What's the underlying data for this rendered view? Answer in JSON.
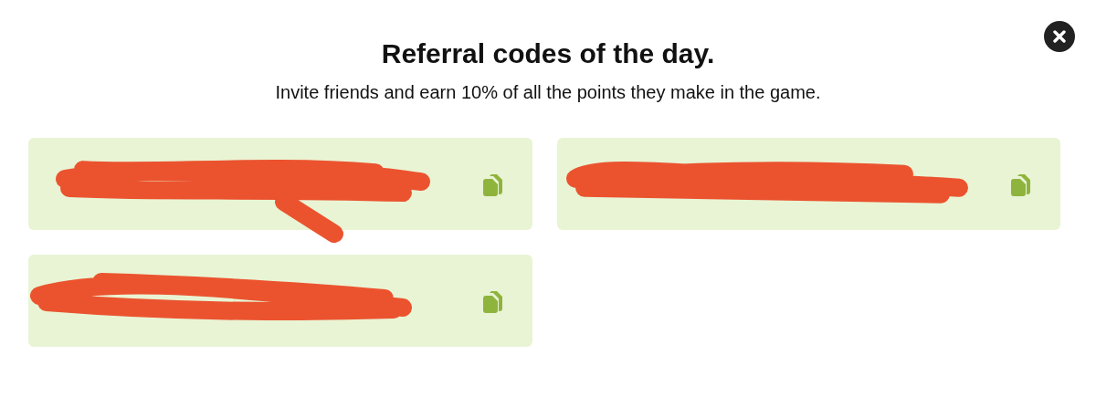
{
  "dialog": {
    "title": "Referral codes of the day.",
    "subtitle": "Invite friends and earn 10% of all the points they make in the game."
  },
  "codes": [
    {
      "redacted": true
    },
    {
      "redacted": true
    },
    {
      "redacted": true
    }
  ]
}
